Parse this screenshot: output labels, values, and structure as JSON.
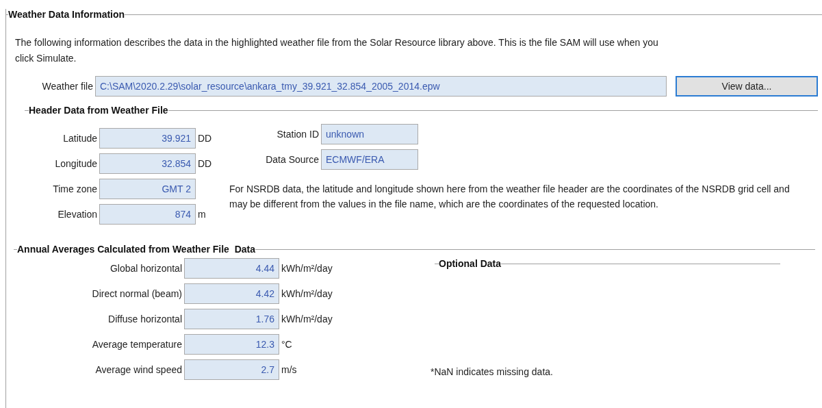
{
  "group": {
    "title": "Weather Data Information"
  },
  "description": "The following information describes the data in the highlighted weather file from the Solar Resource library above. This is the file SAM will use when you click Simulate.",
  "weather_file": {
    "label": "Weather file",
    "value": "C:\\SAM\\2020.2.29\\solar_resource\\ankara_tmy_39.921_32.854_2005_2014.epw",
    "button": "View data..."
  },
  "header_data": {
    "title": "Header Data from Weather File",
    "left_fields": [
      {
        "label": "Latitude",
        "value": "39.921",
        "unit": "DD"
      },
      {
        "label": "Longitude",
        "value": "32.854",
        "unit": "DD"
      },
      {
        "label": "Time zone",
        "value": "GMT 2"
      },
      {
        "label": "Elevation",
        "value": "874",
        "unit": "m"
      }
    ],
    "right_fields": [
      {
        "label": "Station ID",
        "value": "unknown"
      },
      {
        "label": "Data Source",
        "value": "ECMWF/ERA"
      }
    ],
    "note": "For NSRDB data, the latitude and longitude shown here from the weather file header are the coordinates of the NSRDB grid cell and may be different from the values in the file name, which are the coordinates of the requested location."
  },
  "annual_averages": {
    "title": "Annual Averages Calculated from Weather File  Data",
    "fields": [
      {
        "label": "Global horizontal",
        "value": "4.44",
        "unit": "kWh/m²/day"
      },
      {
        "label": "Direct normal (beam)",
        "value": "4.42",
        "unit": "kWh/m²/day"
      },
      {
        "label": "Diffuse horizontal",
        "value": "1.76",
        "unit": "kWh/m²/day"
      },
      {
        "label": "Average temperature",
        "value": "12.3",
        "unit": "°C"
      },
      {
        "label": "Average wind speed",
        "value": "2.7",
        "unit": "m/s"
      }
    ]
  },
  "optional_data": {
    "title": "Optional Data",
    "note": "*NaN indicates missing data."
  }
}
